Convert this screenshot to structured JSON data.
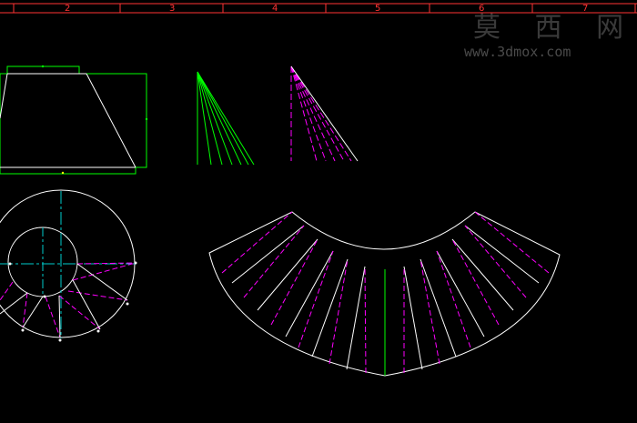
{
  "ruler": {
    "numbers": [
      "2",
      "3",
      "4",
      "5",
      "6",
      "7"
    ],
    "color": "#ff3333"
  },
  "watermark": {
    "brand": "莫 西 网",
    "url": "www.3dmox.com"
  },
  "colors": {
    "background": "#000000",
    "outline": "#ffffff",
    "green": "#00ff00",
    "magenta": "#ff00ff",
    "cyan": "#00cccc",
    "red": "#ff3333"
  }
}
